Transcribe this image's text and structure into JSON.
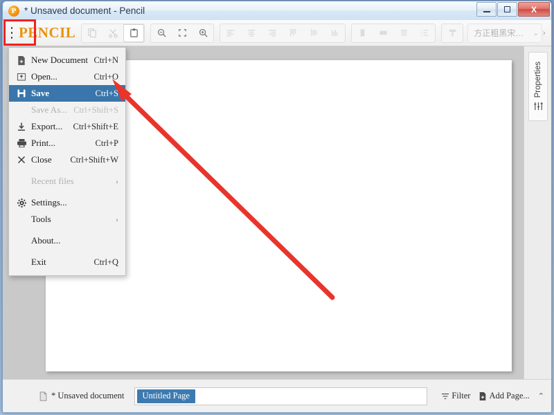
{
  "window": {
    "title": "* Unsaved document - Pencil",
    "app_icon": "pencil-logo-icon",
    "controls": {
      "minimize": "minimize-icon",
      "maximize": "maximize-icon",
      "close": "X"
    }
  },
  "toolbar": {
    "menu_button": "hamburger-menu-icon",
    "brand": "PENCIL",
    "groups": [
      {
        "items": [
          {
            "name": "copy-button",
            "icon": "copy-icon",
            "enabled": false
          },
          {
            "name": "cut-button",
            "icon": "scissors-icon",
            "enabled": false
          },
          {
            "name": "paste-button",
            "icon": "clipboard-icon",
            "enabled": true
          }
        ]
      },
      {
        "items": [
          {
            "name": "zoom-out-button",
            "icon": "magnifier-minus-icon",
            "enabled": true
          },
          {
            "name": "zoom-fit-button",
            "icon": "fit-screen-icon",
            "enabled": true
          },
          {
            "name": "zoom-in-button",
            "icon": "magnifier-plus-icon",
            "enabled": true
          }
        ]
      },
      {
        "items": [
          {
            "name": "align-left-button",
            "icon": "align-left-icon",
            "enabled": false
          },
          {
            "name": "align-center-button",
            "icon": "align-center-icon",
            "enabled": false
          },
          {
            "name": "align-right-button",
            "icon": "align-right-icon",
            "enabled": false
          },
          {
            "name": "align-top-button",
            "icon": "align-top-icon",
            "enabled": false
          },
          {
            "name": "align-middle-button",
            "icon": "align-middle-icon",
            "enabled": false
          },
          {
            "name": "align-bottom-button",
            "icon": "align-bottom-icon",
            "enabled": false
          }
        ]
      },
      {
        "items": [
          {
            "name": "distribute-horizontal-button",
            "icon": "distribute-horizontal-icon",
            "enabled": false
          },
          {
            "name": "distribute-vertical-button",
            "icon": "distribute-vertical-icon",
            "enabled": false
          },
          {
            "name": "group-button",
            "icon": "group-icon",
            "enabled": false
          },
          {
            "name": "order-button",
            "icon": "order-list-icon",
            "enabled": false
          }
        ]
      },
      {
        "items": [
          {
            "name": "text-format-button",
            "icon": "text-format-icon",
            "enabled": false
          }
        ]
      }
    ],
    "font_selector": {
      "value": "方正粗黑宋…",
      "chevron": "chevron-down-icon"
    },
    "overflow": "chevron-right-icon"
  },
  "menu": {
    "items": [
      {
        "label": "New Document",
        "accel": "Ctrl+N",
        "icon": "new-document-icon",
        "state": "normal"
      },
      {
        "label": "Open...",
        "accel": "Ctrl+O",
        "icon": "open-folder-icon",
        "state": "normal"
      },
      {
        "label": "Save",
        "accel": "Ctrl+S",
        "icon": "floppy-save-icon",
        "state": "selected"
      },
      {
        "label": "Save As...",
        "accel": "Ctrl+Shift+S",
        "icon": "",
        "state": "disabled"
      },
      {
        "label": "Export...",
        "accel": "Ctrl+Shift+E",
        "icon": "export-down-icon",
        "state": "normal"
      },
      {
        "label": "Print...",
        "accel": "Ctrl+P",
        "icon": "printer-icon",
        "state": "normal"
      },
      {
        "label": "Close",
        "accel": "Ctrl+Shift+W",
        "icon": "close-x-icon",
        "state": "normal"
      },
      {
        "label": "__SEP__",
        "accel": "",
        "icon": "",
        "state": "sep"
      },
      {
        "label": "Recent files",
        "accel": "",
        "icon": "",
        "state": "disabled",
        "submenu": "›"
      },
      {
        "label": "__SEP__",
        "accel": "",
        "icon": "",
        "state": "sep"
      },
      {
        "label": "Settings...",
        "accel": "",
        "icon": "gear-icon",
        "state": "normal"
      },
      {
        "label": "Tools",
        "accel": "",
        "icon": "",
        "state": "normal",
        "submenu": "›"
      },
      {
        "label": "__SEP__",
        "accel": "",
        "icon": "",
        "state": "sep"
      },
      {
        "label": "About...",
        "accel": "",
        "icon": "",
        "state": "normal"
      },
      {
        "label": "__SEP__",
        "accel": "",
        "icon": "",
        "state": "sep"
      },
      {
        "label": "Exit",
        "accel": "Ctrl+Q",
        "icon": "",
        "state": "normal"
      }
    ]
  },
  "properties_panel": {
    "label": "Properties",
    "icon": "sliders-icon"
  },
  "statusbar": {
    "document_icon": "document-icon",
    "document_name": "* Unsaved document",
    "page_tab": "Untitled Page",
    "filter_icon": "filter-icon",
    "filter_label": "Filter",
    "add_page_icon": "add-page-icon",
    "add_page_label": "Add Page...",
    "collapse_icon": "chevron-up-icon"
  },
  "annotations": {
    "highlight_color": "#f42020",
    "arrow_color": "#e8352c",
    "highlight_target": "hamburger-menu-icon",
    "arrow_target": "save-menu-item"
  },
  "colors": {
    "brand_orange": "#e8930f",
    "menu_selection_blue": "#3a76ab",
    "page_chip_blue": "#3d7ab0",
    "canvas_gray": "#c9c9c9"
  }
}
